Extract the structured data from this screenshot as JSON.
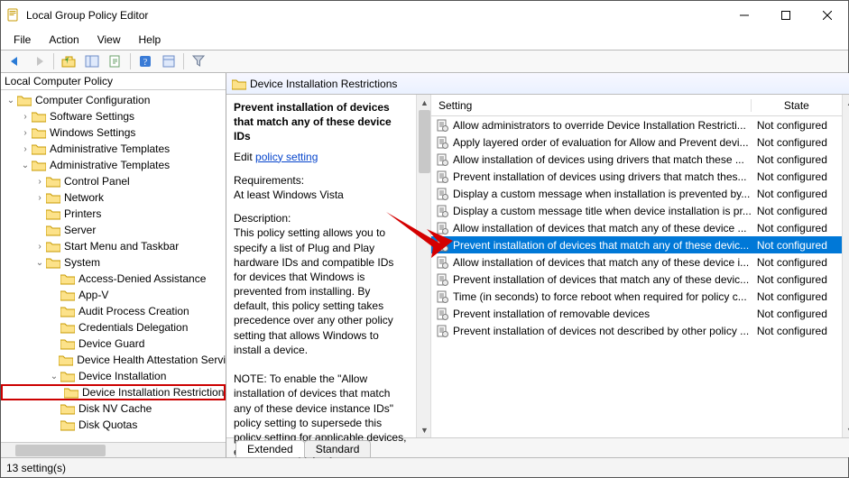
{
  "title": "Local Group Policy Editor",
  "menubar": [
    "File",
    "Action",
    "View",
    "Help"
  ],
  "left_header": "Local Computer Policy",
  "tree": [
    {
      "depth": 0,
      "exp": "open",
      "label": "Computer Configuration"
    },
    {
      "depth": 1,
      "exp": "closed",
      "label": "Software Settings"
    },
    {
      "depth": 1,
      "exp": "closed",
      "label": "Windows Settings"
    },
    {
      "depth": 1,
      "exp": "closed",
      "label": "Administrative Templates"
    },
    {
      "depth": 1,
      "exp": "open",
      "label": "Administrative Templates"
    },
    {
      "depth": 2,
      "exp": "closed",
      "label": "Control Panel"
    },
    {
      "depth": 2,
      "exp": "closed",
      "label": "Network"
    },
    {
      "depth": 2,
      "exp": "none",
      "label": "Printers"
    },
    {
      "depth": 2,
      "exp": "none",
      "label": "Server"
    },
    {
      "depth": 2,
      "exp": "closed",
      "label": "Start Menu and Taskbar"
    },
    {
      "depth": 2,
      "exp": "open",
      "label": "System"
    },
    {
      "depth": 3,
      "exp": "none",
      "label": "Access-Denied Assistance"
    },
    {
      "depth": 3,
      "exp": "none",
      "label": "App-V"
    },
    {
      "depth": 3,
      "exp": "none",
      "label": "Audit Process Creation"
    },
    {
      "depth": 3,
      "exp": "none",
      "label": "Credentials Delegation"
    },
    {
      "depth": 3,
      "exp": "none",
      "label": "Device Guard"
    },
    {
      "depth": 3,
      "exp": "none",
      "label": "Device Health Attestation Servi"
    },
    {
      "depth": 3,
      "exp": "open",
      "label": "Device Installation"
    },
    {
      "depth": 4,
      "exp": "none",
      "label": "Device Installation Restrictions",
      "boxed": true
    },
    {
      "depth": 3,
      "exp": "none",
      "label": "Disk NV Cache"
    },
    {
      "depth": 3,
      "exp": "none",
      "label": "Disk Quotas"
    }
  ],
  "crumb": "Device Installation Restrictions",
  "details_title": "Prevent installation of devices that match any of these device IDs",
  "details_edit": "Edit ",
  "details_link": "policy setting",
  "details_req_head": "Requirements:",
  "details_req": "At least Windows Vista",
  "details_desc_head": "Description:",
  "details_desc": "This policy setting allows you to specify a list of Plug and Play hardware IDs and compatible IDs for devices that Windows is prevented from installing. By default, this policy setting takes precedence over any other policy setting that allows Windows to install a device.",
  "details_note": "NOTE: To enable the \"Allow installation of devices that match any of these device instance IDs\" policy setting to supersede this policy setting for applicable devices, enable the \"Apply layered",
  "list_cols": {
    "setting": "Setting",
    "state": "State"
  },
  "settings": [
    {
      "label": "Allow administrators to override Device Installation Restricti...",
      "state": "Not configured"
    },
    {
      "label": "Apply layered order of evaluation for Allow and Prevent devi...",
      "state": "Not configured"
    },
    {
      "label": "Allow installation of devices using drivers that match these ...",
      "state": "Not configured"
    },
    {
      "label": "Prevent installation of devices using drivers that match thes...",
      "state": "Not configured"
    },
    {
      "label": "Display a custom message when installation is prevented by...",
      "state": "Not configured"
    },
    {
      "label": "Display a custom message title when device installation is pr...",
      "state": "Not configured"
    },
    {
      "label": "Allow installation of devices that match any of these device ...",
      "state": "Not configured"
    },
    {
      "label": "Prevent installation of devices that match any of these devic...",
      "state": "Not configured",
      "sel": true
    },
    {
      "label": "Allow installation of devices that match any of these device i...",
      "state": "Not configured"
    },
    {
      "label": "Prevent installation of devices that match any of these devic...",
      "state": "Not configured"
    },
    {
      "label": "Time (in seconds) to force reboot when required for policy c...",
      "state": "Not configured"
    },
    {
      "label": "Prevent installation of removable devices",
      "state": "Not configured"
    },
    {
      "label": "Prevent installation of devices not described by other policy ...",
      "state": "Not configured"
    }
  ],
  "tabs": {
    "extended": "Extended",
    "standard": "Standard"
  },
  "status": "13 setting(s)"
}
